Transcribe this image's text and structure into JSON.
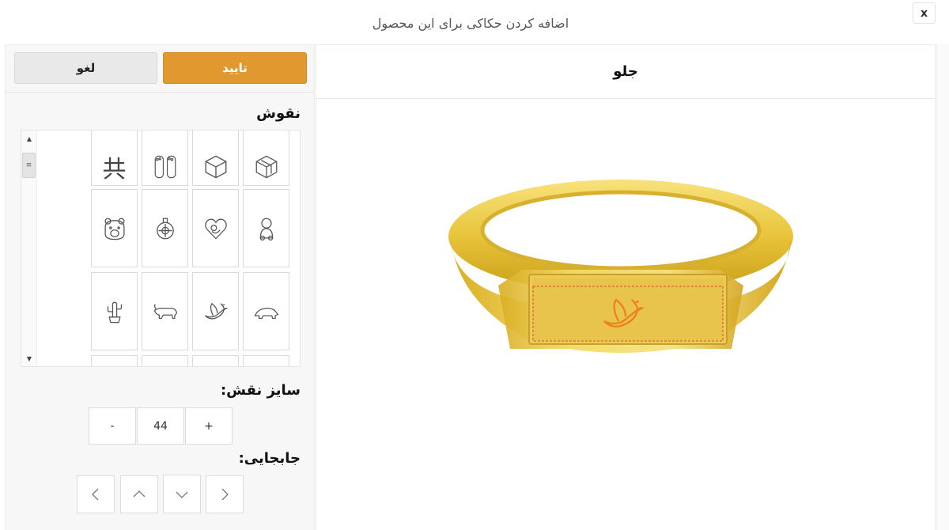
{
  "dialog": {
    "title": "اضافه کردن حکاکی برای این محصول",
    "close_label": "x"
  },
  "actions": {
    "confirm_label": "تایید",
    "cancel_label": "لغو"
  },
  "patterns": {
    "title": "نقوش",
    "icons": [
      [
        "3d-box-icon",
        "cube-icon",
        "footprints-icon",
        "chinese-character-icon"
      ],
      [
        "baby-icon",
        "heart-baby-icon",
        "ornament-icon",
        "bear-icon"
      ],
      [
        "bear-walking-icon",
        "dove-icon",
        "bull-icon",
        "cactus-icon"
      ]
    ],
    "chinese_char": "共"
  },
  "size": {
    "title": "سایز نقش:",
    "plus": "+",
    "value": "44",
    "minus": "-"
  },
  "move": {
    "title": "جابجایی:"
  },
  "preview": {
    "tab_label": "جلو",
    "engraving_icon": "dove-icon"
  },
  "colors": {
    "accent": "#e1992f",
    "engraving": "#f07f1a",
    "ring_gold": "#e9c63a"
  }
}
